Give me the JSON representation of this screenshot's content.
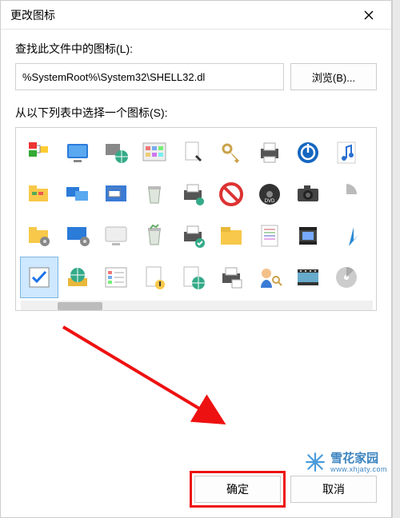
{
  "titlebar": {
    "title": "更改图标"
  },
  "labels": {
    "look_in": "查找此文件中的图标(L):",
    "select_from_list": "从以下列表中选择一个图标(S):"
  },
  "path": {
    "value": "%SystemRoot%\\System32\\SHELL32.dl",
    "browse_label": "浏览(B)..."
  },
  "buttons": {
    "ok": "确定",
    "cancel": "取消"
  },
  "icons": [
    {
      "name": "settings-tree-icon",
      "selected": false
    },
    {
      "name": "monitor-icon",
      "selected": false
    },
    {
      "name": "network-globe-icon",
      "selected": false
    },
    {
      "name": "control-panel-icon",
      "selected": false
    },
    {
      "name": "document-cursor-icon",
      "selected": false
    },
    {
      "name": "keys-icon",
      "selected": false
    },
    {
      "name": "printer-icon",
      "selected": false
    },
    {
      "name": "power-icon",
      "selected": false
    },
    {
      "name": "music-note-icon",
      "selected": false
    },
    {
      "name": "folder-tree-icon",
      "selected": false
    },
    {
      "name": "dual-monitor-icon",
      "selected": false
    },
    {
      "name": "desktop-window-icon",
      "selected": false
    },
    {
      "name": "recycle-empty-icon",
      "selected": false
    },
    {
      "name": "printer-network-icon",
      "selected": false
    },
    {
      "name": "no-entry-icon",
      "selected": false
    },
    {
      "name": "dvd-disc-icon",
      "selected": false
    },
    {
      "name": "camera-icon",
      "selected": false
    },
    {
      "name": "partial-disc-icon",
      "selected": false
    },
    {
      "name": "folder-gear-icon",
      "selected": false
    },
    {
      "name": "monitor-gear-icon",
      "selected": false
    },
    {
      "name": "monitor-blank-icon",
      "selected": false
    },
    {
      "name": "recycle-full-icon",
      "selected": false
    },
    {
      "name": "printer-ok-icon",
      "selected": false
    },
    {
      "name": "folder-yellow-icon",
      "selected": false
    },
    {
      "name": "list-document-icon",
      "selected": false
    },
    {
      "name": "film-clip-icon",
      "selected": false
    },
    {
      "name": "download-arrow-icon",
      "selected": false
    },
    {
      "name": "checkbox-checked-icon",
      "selected": true
    },
    {
      "name": "globe-box-icon",
      "selected": false
    },
    {
      "name": "list-apps-icon",
      "selected": false
    },
    {
      "name": "page-touch-icon",
      "selected": false
    },
    {
      "name": "globe-page-icon",
      "selected": false
    },
    {
      "name": "printer-page-icon",
      "selected": false
    },
    {
      "name": "user-key-icon",
      "selected": false
    },
    {
      "name": "film-frames-icon",
      "selected": false
    },
    {
      "name": "disc-gray-icon",
      "selected": false
    }
  ],
  "watermark": {
    "name": "雪花家园",
    "url": "www.xhjaty.com"
  }
}
